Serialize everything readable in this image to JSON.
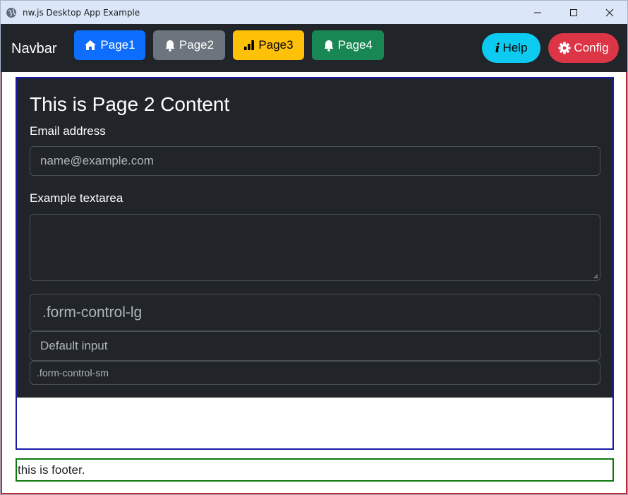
{
  "window": {
    "title": "nw.js Desktop App Example"
  },
  "navbar": {
    "brand": "Navbar",
    "buttons": [
      {
        "label": "Page1",
        "icon": "house-icon"
      },
      {
        "label": "Page2",
        "icon": "bell-icon"
      },
      {
        "label": "Page3",
        "icon": "bar-chart-icon"
      },
      {
        "label": "Page4",
        "icon": "bell-icon"
      }
    ],
    "help": {
      "label": "Help",
      "icon": "info-icon"
    },
    "config": {
      "label": "Config",
      "icon": "gear-icon"
    }
  },
  "content": {
    "title": "This is Page 2 Content",
    "email_label": "Email address",
    "email_placeholder": "name@example.com",
    "textarea_label": "Example textarea",
    "input_lg_placeholder": ".form-control-lg",
    "input_default_placeholder": "Default input",
    "input_sm_placeholder": ".form-control-sm"
  },
  "footer": {
    "text": "this is footer."
  },
  "colors": {
    "navbar_bg": "#212529",
    "primary": "#0d6efd",
    "secondary": "#6c757d",
    "warning": "#ffc107",
    "success": "#198754",
    "info": "#0dcaf0",
    "danger": "#dc3545",
    "frame_red": "#c0282d",
    "frame_blue": "#1a1aa8",
    "frame_green": "#0f7a0f"
  }
}
